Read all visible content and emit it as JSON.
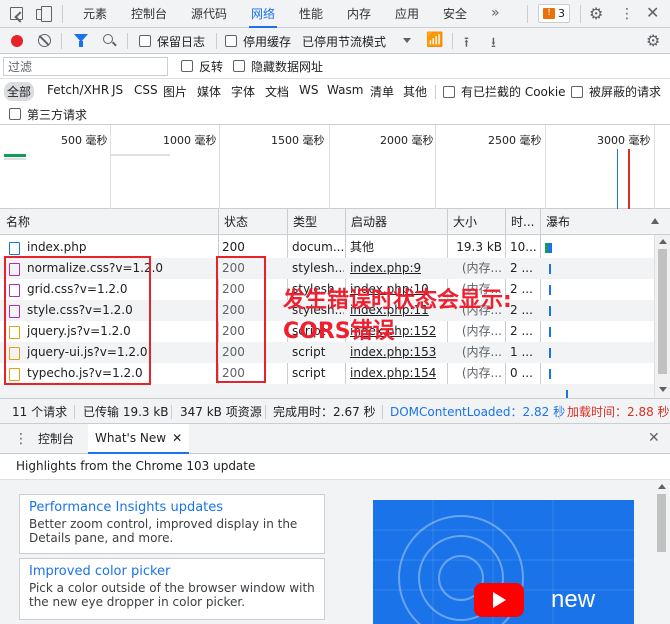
{
  "tabs": [
    {
      "label": "元素"
    },
    {
      "label": "控制台"
    },
    {
      "label": "源代码"
    },
    {
      "label": "网络"
    },
    {
      "label": "性能"
    },
    {
      "label": "内存"
    },
    {
      "label": "应用"
    },
    {
      "label": "安全"
    }
  ],
  "issues_count": "3",
  "toolbar": {
    "preserve_log": "保留日志",
    "disable_cache": "停用缓存",
    "throttle": "已停用节流模式"
  },
  "filter": {
    "placeholder": "过滤",
    "invert": "反转",
    "hide_data_urls": "隐藏数据网址"
  },
  "types": [
    "全部",
    "Fetch/XHR",
    "JS",
    "CSS",
    "图片",
    "媒体",
    "字体",
    "文档",
    "WS",
    "Wasm",
    "清单",
    "其他"
  ],
  "blocked_cookies": "有已拦截的 Cookie",
  "blocked_requests": "被屏蔽的请求",
  "third_party": "第三方请求",
  "timeline_ticks": [
    "500 毫秒",
    "1000 毫秒",
    "1500 毫秒",
    "2000 毫秒",
    "2500 毫秒",
    "3000 毫秒"
  ],
  "columns": [
    "名称",
    "状态",
    "类型",
    "启动器",
    "大小",
    "时...",
    "瀑布"
  ],
  "rows": [
    {
      "name": "index.php",
      "status": "200",
      "type": "docum...",
      "initiator": "其他",
      "size": "19.3 kB",
      "time": "10..."
    },
    {
      "name": "normalize.css?v=1.2.0",
      "status": "200",
      "type": "stylesh...",
      "initiator": "index.php:9",
      "size": "(内存...",
      "time": "2 ..."
    },
    {
      "name": "grid.css?v=1.2.0",
      "status": "200",
      "type": "stylesh...",
      "initiator": "index.php:10",
      "size": "(内存...",
      "time": "2 ..."
    },
    {
      "name": "style.css?v=1.2.0",
      "status": "200",
      "type": "stylesh...",
      "initiator": "index.php:11",
      "size": "(内存...",
      "time": "2 ..."
    },
    {
      "name": "jquery.js?v=1.2.0",
      "status": "200",
      "type": "script",
      "initiator": "index.php:152",
      "size": "(内存...",
      "time": "2 ..."
    },
    {
      "name": "jquery-ui.js?v=1.2.0",
      "status": "200",
      "type": "script",
      "initiator": "index.php:153",
      "size": "(内存...",
      "time": "1 ..."
    },
    {
      "name": "typecho.js?v=1.2.0",
      "status": "200",
      "type": "script",
      "initiator": "index.php:154",
      "size": "(内存...",
      "time": "0 ..."
    }
  ],
  "annotation": {
    "line1": "发生错误时状态会显示:",
    "line2": "CORS错误"
  },
  "status": {
    "requests": "11 个请求",
    "transferred": "已传输 19.3 kB",
    "resources": "347 kB 项资源",
    "finish": "完成用时：2.67 秒",
    "dcl": "DOMContentLoaded：2.82 秒",
    "load": "加载时间：2.88 秒"
  },
  "drawer": {
    "tab_console": "控制台",
    "tab_whatsnew": "What's New",
    "title": "Highlights from the Chrome 103 update",
    "cards": [
      {
        "title": "Performance Insights updates",
        "desc": "Better zoom control, improved display in the Details pane, and more."
      },
      {
        "title": "Improved color picker",
        "desc": "Pick a color outside of the browser window with the new eye dropper in color picker."
      }
    ],
    "video_label": "new"
  },
  "colors": {
    "accent": "#1a73e8",
    "record_red": "#e8222a",
    "annotation_red": "#f01f30",
    "load_red": "#d93025"
  }
}
